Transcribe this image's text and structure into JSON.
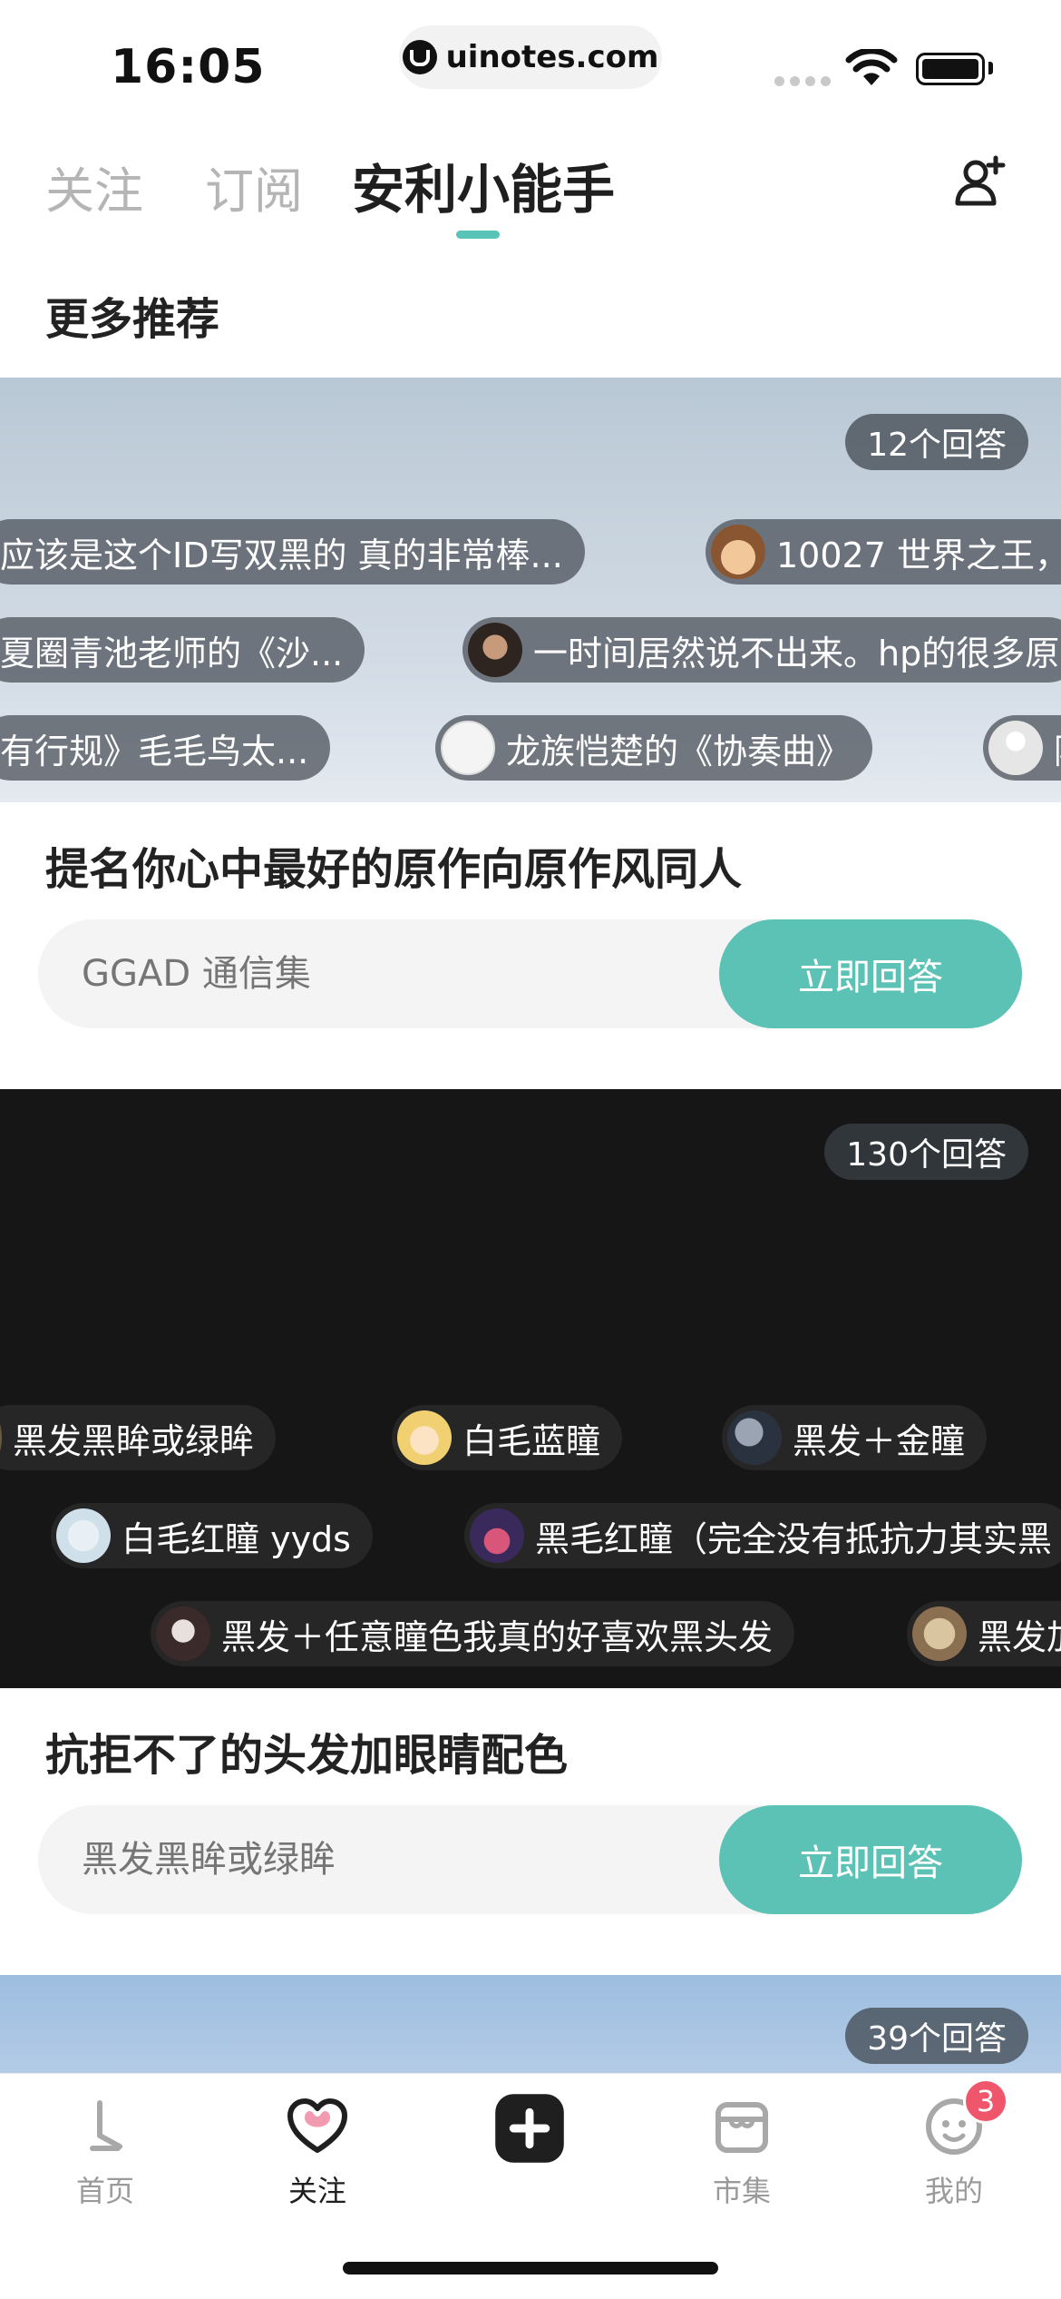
{
  "status_bar": {
    "time": "16:05",
    "url": "uinotes.com"
  },
  "tabs": [
    {
      "label": "关注"
    },
    {
      "label": "订阅"
    },
    {
      "label": "安利小能手",
      "active": true
    }
  ],
  "add_user_icon": "add-user-icon",
  "section_title": "更多推荐",
  "cards": [
    {
      "count": "12个回答",
      "chips": [
        {
          "text": "应该是这个ID写双黑的 真的非常棒..."
        },
        {
          "text": "10027 世界之王，"
        },
        {
          "text": "夏圈青池老师的《沙..."
        },
        {
          "text": "一时间居然说不出来。hp的很多原"
        },
        {
          "text": "有行规》毛毛鸟太..."
        },
        {
          "text": "龙族恺楚的《协奏曲》"
        },
        {
          "text": "阿"
        }
      ],
      "question": "提名你心中最好的原作向原作风同人",
      "placeholder": "GGAD 通信集",
      "button": "立即回答"
    },
    {
      "count": "130个回答",
      "chips": [
        {
          "text": "黑发黑眸或绿眸"
        },
        {
          "text": "白毛蓝瞳"
        },
        {
          "text": "黑发＋金瞳"
        },
        {
          "text": "白毛红瞳 yyds"
        },
        {
          "text": "黑毛红瞳（完全没有抵抗力其实黑"
        },
        {
          "text": "黑发＋任意瞳色我真的好喜欢黑头发"
        },
        {
          "text": "黑发加"
        }
      ],
      "question": "抗拒不了的头发加眼睛配色",
      "placeholder": "黑发黑眸或绿眸",
      "button": "立即回答"
    },
    {
      "count": "39个回答"
    }
  ],
  "bottom_nav": [
    {
      "label": "首页",
      "icon": "home-icon"
    },
    {
      "label": "关注",
      "icon": "heart-icon",
      "active": true
    },
    {
      "label": "",
      "icon": "plus-icon"
    },
    {
      "label": "市集",
      "icon": "market-icon"
    },
    {
      "label": "我的",
      "icon": "smiley-icon",
      "badge": "3"
    }
  ],
  "colors": {
    "accent": "#5cc2b5",
    "badge": "#f0566b",
    "chip_bg": "#464c54"
  }
}
